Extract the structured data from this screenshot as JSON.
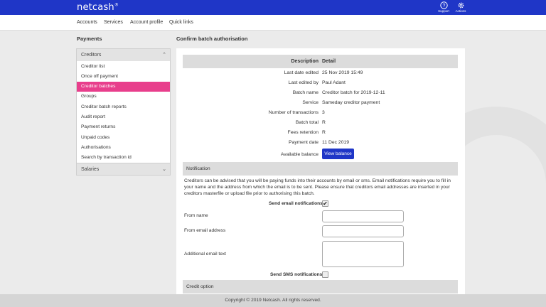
{
  "header": {
    "logo": "netcash",
    "logo_mark": "®",
    "support_label": "Support",
    "actions_label": "Actions"
  },
  "nav": [
    "Accounts",
    "Services",
    "Account profile",
    "Quick links"
  ],
  "left_title": "Payments",
  "main_title": "Confirm batch authorisation",
  "sidebar": {
    "section": "Creditors",
    "items": [
      {
        "label": "Creditor list",
        "active": false
      },
      {
        "label": "Once off payment",
        "active": false
      },
      {
        "label": "Creditor batches",
        "active": true
      },
      {
        "label": "Groups",
        "active": false
      },
      {
        "label": "Creditor batch reports",
        "active": false
      },
      {
        "label": "Audit report",
        "active": false
      },
      {
        "label": "Payment returns",
        "active": false
      },
      {
        "label": "Unpaid codes",
        "active": false
      },
      {
        "label": "Authorisations",
        "active": false
      },
      {
        "label": "Search by transaction id",
        "active": false
      }
    ],
    "footer_section": "Salaries"
  },
  "details": {
    "col_description": "Description",
    "col_detail": "Detail",
    "rows": [
      {
        "label": "Last date edited",
        "value": "25 Nov 2019 15:49"
      },
      {
        "label": "Last edited by",
        "value": "Paul Adant"
      },
      {
        "label": "Batch name",
        "value": "Creditor batch for 2019-12-11"
      },
      {
        "label": "Service",
        "value": "Sameday creditor payment"
      },
      {
        "label": "Number of transactions",
        "value": "3"
      },
      {
        "label": "Batch total",
        "value": "R"
      },
      {
        "label": "Fees retention",
        "value": "R"
      },
      {
        "label": "Payment date",
        "value": "11 Dec 2019"
      }
    ],
    "available_balance_label": "Available balance",
    "view_balance_button": "View balance"
  },
  "notification": {
    "title": "Notification",
    "text": "Creditors can be advised that you will be paying funds into their accounts by email or sms. Email notifications require you to fill in your name and the address from which the email is to be sent. Please ensure that creditors email addresses are inserted in your creditors masterfile or upload file prior to authorising this batch.",
    "send_email_label": "Send email notifications",
    "send_email_checked": true,
    "from_name_label": "From name",
    "from_name_value": "",
    "from_email_label": "From email address",
    "from_email_value": "",
    "additional_text_label": "Additional email text",
    "additional_text_value": "",
    "send_sms_label": "Send SMS notifications",
    "send_sms_checked": false
  },
  "credit_option": {
    "title": "Credit option"
  },
  "footer": "Copyright © 2019 Netcash. All rights reserved."
}
